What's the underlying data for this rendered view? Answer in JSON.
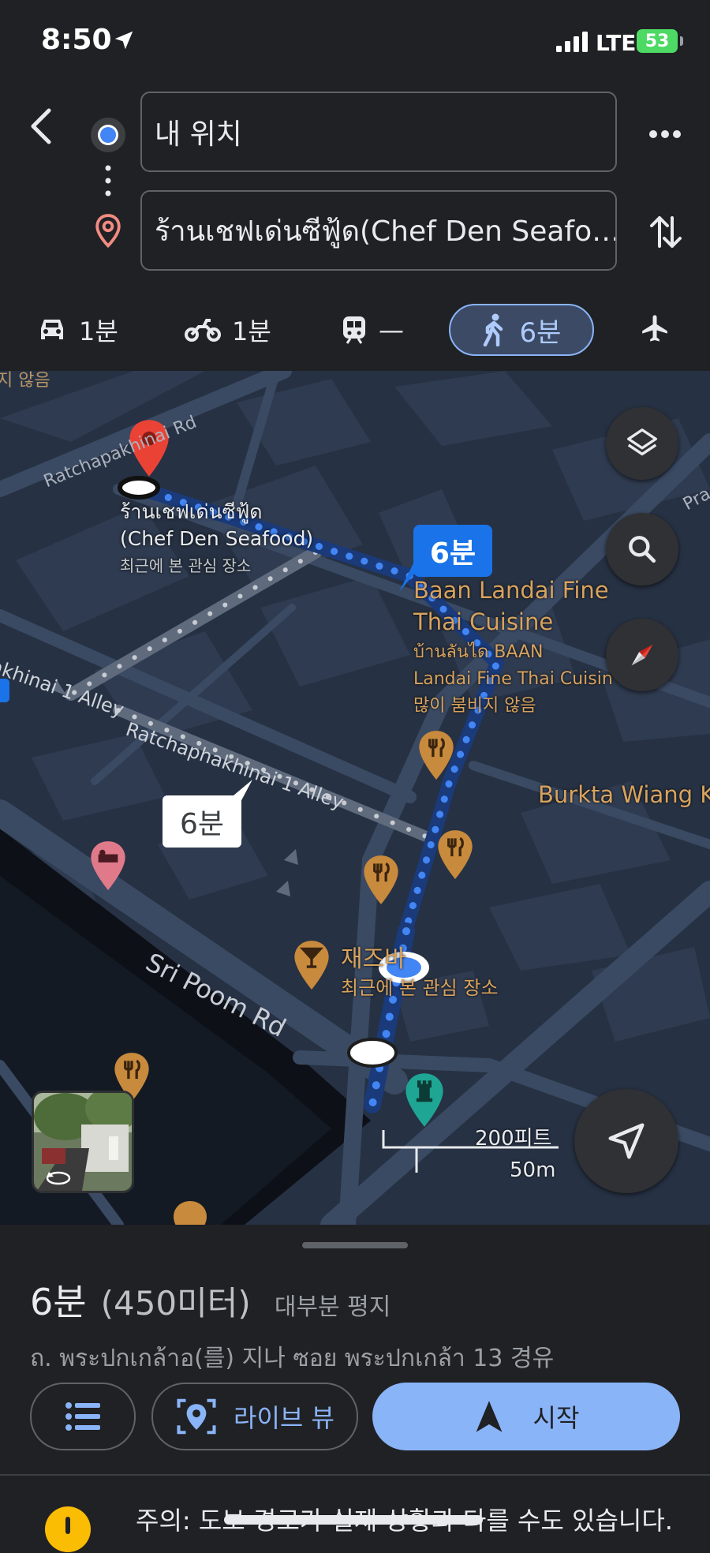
{
  "status": {
    "time": "8:50",
    "network": "LTE",
    "battery": "53"
  },
  "route": {
    "origin": "내 위치",
    "destination": "ร้านเชฟเด่นซีฟู้ด(Chef Den Seafo…"
  },
  "modes": [
    {
      "name": "car",
      "icon": "car-icon",
      "label": "1분"
    },
    {
      "name": "motorcycle",
      "icon": "motorcycle-icon",
      "label": "1분"
    },
    {
      "name": "transit",
      "icon": "train-icon",
      "label": "—"
    },
    {
      "name": "walk",
      "icon": "walk-icon",
      "label": "6분",
      "selected": true
    },
    {
      "name": "flight",
      "icon": "airplane-icon",
      "label": ""
    }
  ],
  "map": {
    "street_labels": {
      "ratchapakhinai_rd": "Ratchapakhinai Rd",
      "alley_left": "akhinai 1 Alley",
      "alley_main": "Ratchaphakhinai 1 Alley",
      "sri_poom": "Sri Poom Rd",
      "pra": "Pra",
      "top_left": "지 않음"
    },
    "destination": {
      "thai": "ร้านเชฟเด่นซีฟู้ด",
      "english": "(Chef Den Seafood)",
      "note": "최근에 본 관심 장소"
    },
    "route_bubble_main": "6분",
    "route_bubble_alt": "6분",
    "poi_baan": {
      "line1": "Baan Landai Fine",
      "line2": "Thai Cuisine",
      "line3": "บ้านลันได BAAN",
      "line4": "Landai Fine Thai Cuisin",
      "line5": "많이 붐비지 않음"
    },
    "poi_burkta": "Burkta Wiang K",
    "poi_jazz": {
      "name": "재즈바",
      "note": "최근에 본 관심 장소"
    },
    "scale": {
      "feet": "200피트",
      "meters": "50m"
    }
  },
  "summary": {
    "duration": "6분",
    "distance": "(450미터)",
    "terrain": "대부분 평지",
    "via": "ถ. พระปกเกล้าอ(를) 지나 ซอย พระปกเกล้า 13 경유"
  },
  "actions": {
    "steps": "",
    "live_view": "라이브 뷰",
    "start": "시작"
  },
  "warning": "주의: 도보 경로가 실제 상황과 다를 수도 있습니다.",
  "colors": {
    "accent": "#8ab4f8",
    "route": "#4285f4",
    "pin": "#ea4335",
    "poi": "#c88a3c"
  }
}
